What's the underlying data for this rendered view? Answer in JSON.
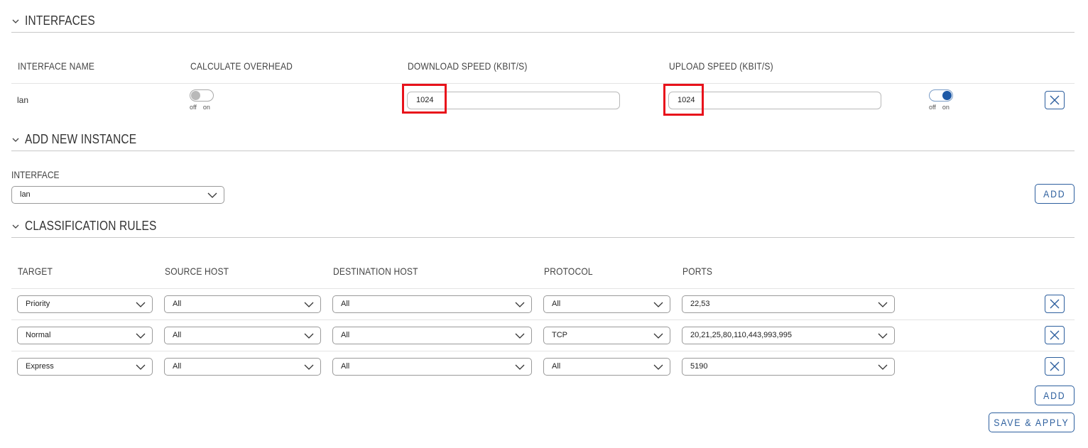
{
  "interfaces": {
    "section_title": "INTERFACES",
    "headers": {
      "name": "INTERFACE NAME",
      "overhead": "CALCULATE OVERHEAD",
      "download": "DOWNLOAD SPEED (KBIT/S)",
      "upload": "UPLOAD SPEED (KBIT/S)"
    },
    "row": {
      "name": "lan",
      "overhead_toggle": {
        "state": "off",
        "off_label": "off",
        "on_label": "on"
      },
      "download": "1024",
      "upload": "1024",
      "enable_toggle": {
        "state": "on",
        "off_label": "off",
        "on_label": "on"
      }
    }
  },
  "add_instance": {
    "section_title": "ADD NEW INSTANCE",
    "interface_label": "INTERFACE",
    "interface_value": "lan",
    "add_label": "ADD"
  },
  "classification": {
    "section_title": "CLASSIFICATION RULES",
    "headers": {
      "target": "TARGET",
      "source": "SOURCE HOST",
      "destination": "DESTINATION HOST",
      "protocol": "PROTOCOL",
      "ports": "PORTS"
    },
    "rows": [
      {
        "target": "Priority",
        "source": "All",
        "destination": "All",
        "protocol": "All",
        "ports": "22,53"
      },
      {
        "target": "Normal",
        "source": "All",
        "destination": "All",
        "protocol": "TCP",
        "ports": "20,21,25,80,110,443,993,995"
      },
      {
        "target": "Express",
        "source": "All",
        "destination": "All",
        "protocol": "All",
        "ports": "5190"
      }
    ],
    "add_label": "ADD",
    "save_label": "SAVE & APPLY"
  },
  "colors": {
    "accent": "#2d5f9e",
    "highlight": "#e8121b",
    "toggle_on": "#1f5aa6"
  },
  "icons": {
    "section": "chevron-down-icon",
    "select": "chevron-down-icon",
    "delete": "close-icon"
  }
}
